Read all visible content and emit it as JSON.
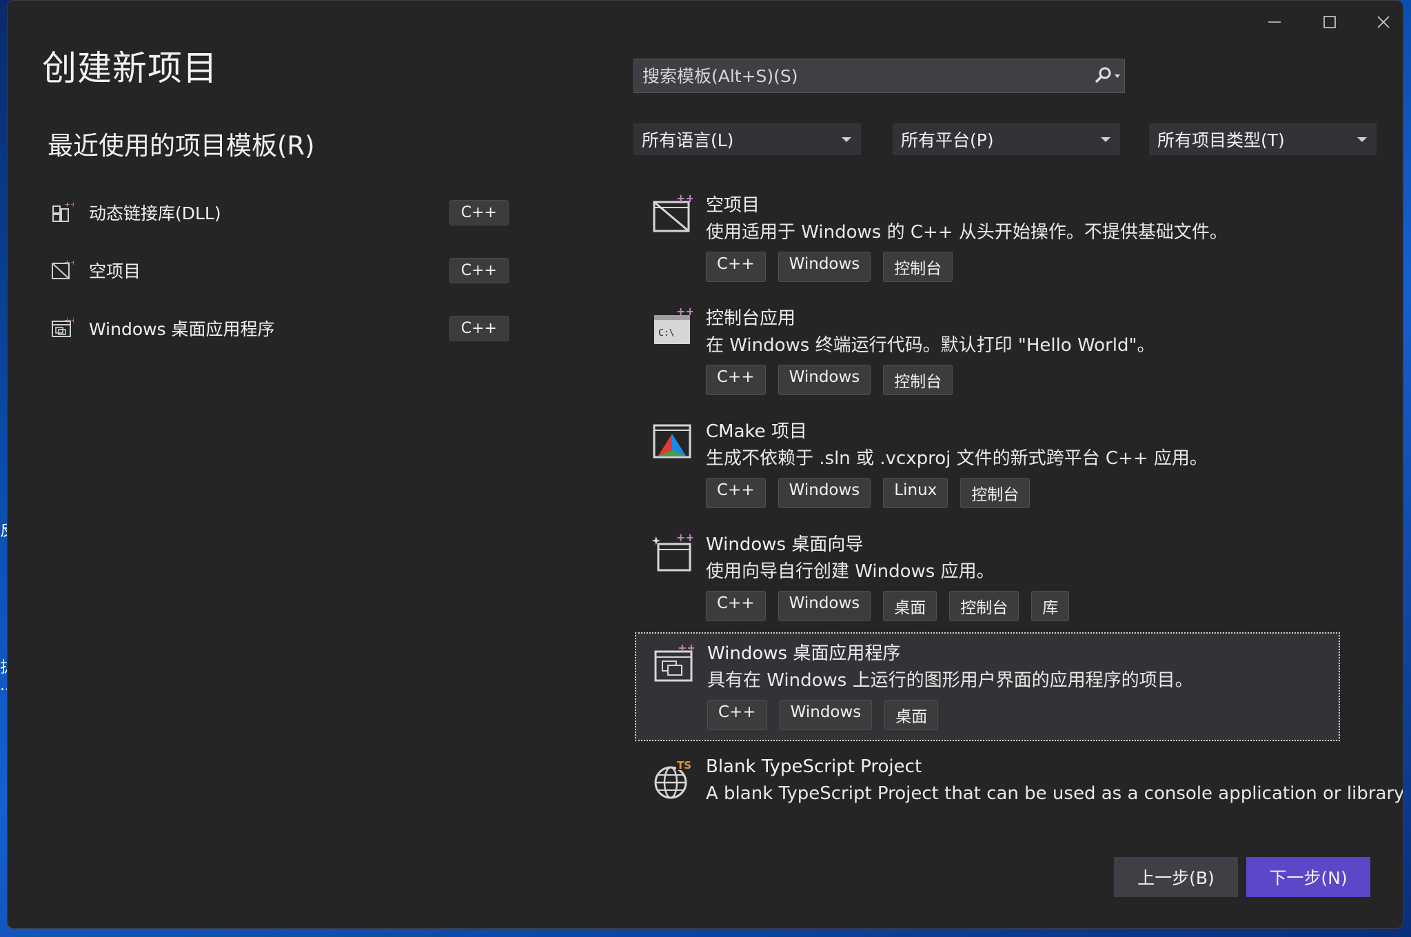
{
  "window": {
    "title": "创建新项目",
    "minimize_glyph": "—",
    "maximize_glyph": "☐",
    "close_glyph": "✕"
  },
  "desktop_edge_labels": [
    "反",
    "拔",
    "..."
  ],
  "recent": {
    "heading": "最近使用的项目模板(R)",
    "items": [
      {
        "label": "动态链接库(DLL)",
        "lang": "C++",
        "icon": "dll-icon"
      },
      {
        "label": "空项目",
        "lang": "C++",
        "icon": "empty-project-icon"
      },
      {
        "label": "Windows 桌面应用程序",
        "lang": "C++",
        "icon": "desktop-app-icon"
      }
    ]
  },
  "search": {
    "placeholder": "搜索模板(Alt+S)(S)",
    "icon": "search-icon"
  },
  "filters": {
    "language": "所有语言(L)",
    "platform": "所有平台(P)",
    "project_type": "所有项目类型(T)"
  },
  "templates": [
    {
      "name": "空项目",
      "description": "使用适用于 Windows 的 C++ 从头开始操作。不提供基础文件。",
      "tags": [
        "C++",
        "Windows",
        "控制台"
      ],
      "icon": "empty-project-icon"
    },
    {
      "name": "控制台应用",
      "description": "在 Windows 终端运行代码。默认打印 \"Hello World\"。",
      "tags": [
        "C++",
        "Windows",
        "控制台"
      ],
      "icon": "console-app-icon"
    },
    {
      "name": "CMake 项目",
      "description": "生成不依赖于 .sln 或 .vcxproj 文件的新式跨平台 C++ 应用。",
      "tags": [
        "C++",
        "Windows",
        "Linux",
        "控制台"
      ],
      "icon": "cmake-icon"
    },
    {
      "name": "Windows 桌面向导",
      "description": "使用向导自行创建 Windows 应用。",
      "tags": [
        "C++",
        "Windows",
        "桌面",
        "控制台",
        "库"
      ],
      "icon": "desktop-wizard-icon"
    },
    {
      "name": "Windows 桌面应用程序",
      "description": "具有在 Windows 上运行的图形用户界面的应用程序的项目。",
      "tags": [
        "C++",
        "Windows",
        "桌面"
      ],
      "icon": "desktop-app-icon",
      "selected": true
    },
    {
      "name": "Blank TypeScript Project",
      "description": "A blank TypeScript Project that can be used as a console application or library.",
      "tags": [],
      "icon": "typescript-globe-icon"
    }
  ],
  "buttons": {
    "back": "上一步(B)",
    "next": "下一步(N)"
  },
  "colors": {
    "dialog_bg": "#252526",
    "accent_button": "#5b47c8",
    "plus_badge": "#c586c0"
  }
}
